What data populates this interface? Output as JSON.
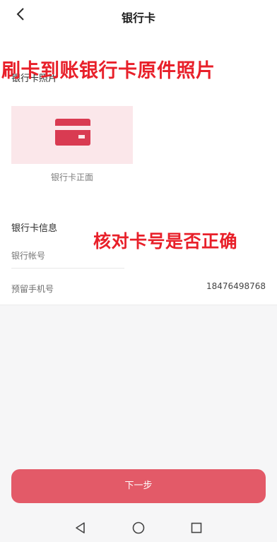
{
  "header": {
    "title": "银行卡",
    "back_icon": "chevron-left-icon"
  },
  "photo_section": {
    "label": "银行卡照片",
    "annotation": "刷卡到账银行卡原件照片",
    "card_icon": "credit-card-icon",
    "card_caption": "银行卡正面"
  },
  "info_section": {
    "label": "银行卡信息",
    "annotation": "核对卡号是否正确",
    "account_placeholder": "银行帐号",
    "phone_label": "预留手机号",
    "phone_value": "18476498768"
  },
  "footer": {
    "next_label": "下一步"
  },
  "navbar": {
    "back_icon": "triangle-back-icon",
    "home_icon": "circle-home-icon",
    "recent_icon": "square-recent-icon"
  },
  "colors": {
    "accent": "#e35a68",
    "annotation": "#e8202a",
    "card_bg": "#fbe7ea",
    "card_icon": "#d93b52"
  }
}
